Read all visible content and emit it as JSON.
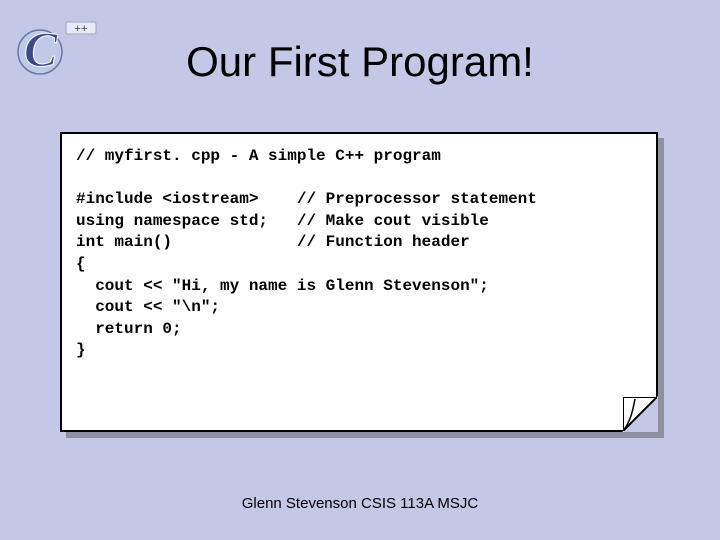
{
  "title": "Our First Program!",
  "code_lines": [
    "// myfirst. cpp - A simple C++ program",
    "",
    "#include <iostream>    // Preprocessor statement",
    "using namespace std;   // Make cout visible",
    "int main()             // Function header",
    "{",
    "  cout << \"Hi, my name is Glenn Stevenson\";",
    "  cout << \"\\n\";",
    "  return 0;",
    "}"
  ],
  "footer": "Glenn Stevenson CSIS 113A MSJC",
  "logo": {
    "primary_letter": "C",
    "superscript": "++"
  }
}
